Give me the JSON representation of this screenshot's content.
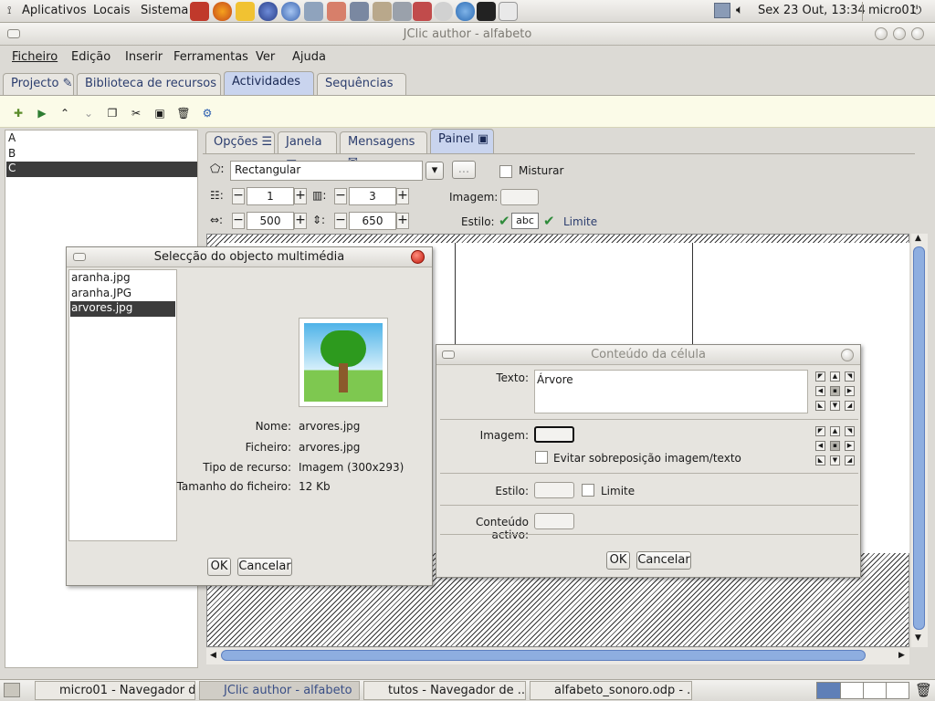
{
  "top_panel": {
    "menus": [
      "Aplicativos",
      "Locais",
      "Sistema"
    ],
    "clock": "Sex 23 Out, 13:34",
    "user": "micro01"
  },
  "window": {
    "title": "JClic author - alfabeto",
    "menu": [
      "Ficheiro",
      "Edição",
      "Inserir",
      "Ferramentas",
      "Ver",
      "Ajuda"
    ],
    "tabs": [
      "Projecto",
      "Biblioteca de recursos",
      "Actividades",
      "Sequências"
    ]
  },
  "activities": [
    "A",
    "B",
    "C"
  ],
  "subtabs": [
    "Opções",
    "Janela",
    "Mensagens",
    "Painel"
  ],
  "panel": {
    "shape": "Rectangular",
    "shape_btn": "...",
    "misturar": "Misturar",
    "rows": "1",
    "cols": "3",
    "width": "500",
    "height": "650",
    "imagem": "Imagem:",
    "estilo": "Estilo:",
    "abc": "abc",
    "limite": "Limite"
  },
  "media_dialog": {
    "title": "Selecção do objecto multimédia",
    "files": [
      "aranha.jpg",
      "aranha.JPG",
      "arvores.jpg"
    ],
    "info": [
      {
        "label": "Nome:",
        "value": "arvores.jpg"
      },
      {
        "label": "Ficheiro:",
        "value": "arvores.jpg"
      },
      {
        "label": "Tipo de recurso:",
        "value": "Imagem (300x293)"
      },
      {
        "label": "Tamanho do ficheiro:",
        "value": "12 Kb"
      }
    ],
    "ok": "OK",
    "cancel": "Cancelar"
  },
  "cell_dialog": {
    "title": "Conteúdo da célula",
    "texto_label": "Texto:",
    "texto_value": "Árvore",
    "imagem_label": "Imagem:",
    "evitar": "Evitar sobreposição imagem/texto",
    "estilo_label": "Estilo:",
    "limite": "Limite",
    "conteudo_label": "Conteúdo activo:",
    "ok": "OK",
    "cancel": "Cancelar"
  },
  "taskbar": [
    "micro01 - Navegador d...",
    "JClic author - alfabeto",
    "tutos - Navegador de ...",
    "alfabeto_sonoro.odp - ..."
  ],
  "colors": {
    "selection": "#3c3c3c",
    "active_tab": "#c9d4ee",
    "scroll": "#8eaee0"
  }
}
